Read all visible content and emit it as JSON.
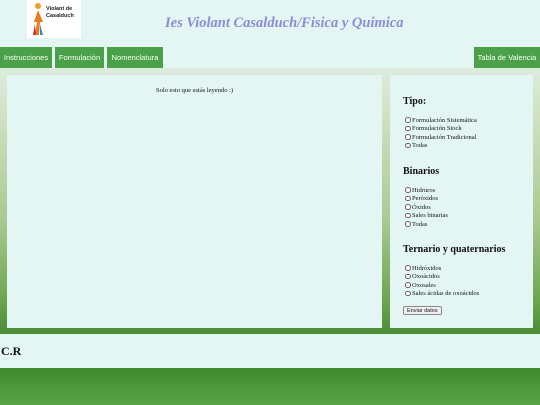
{
  "header": {
    "logo_line1": "Violant de",
    "logo_line2": "Casalduch",
    "title": "Ies Violant Casalduch/Fisica y Quimica"
  },
  "nav": {
    "items": [
      "Instrucciones",
      "Formulación",
      "Nomenclatura"
    ],
    "right_item": "Tabla de Valencia"
  },
  "main": {
    "message": "Solo esto que estás leyendo :)"
  },
  "form": {
    "sections": [
      {
        "title": "Tipo:",
        "options": [
          "Formulación Sistemática",
          "Formulación Stock",
          "Formulación Tradicional",
          "Todas"
        ]
      },
      {
        "title": "Binarios",
        "options": [
          "Hidruros",
          "Peróxidos",
          "Óxidos",
          "Sales binarias",
          "Todas"
        ]
      },
      {
        "title": "Ternario y quaternarios",
        "options": [
          "Hidróxidos",
          "Oxoácidos",
          "Oxosales",
          "Sales ácidas de oxoácidos"
        ]
      }
    ],
    "submit_label": "Enviar datos"
  },
  "footer": {
    "text": "C.R"
  },
  "colors": {
    "nav": "#4aa14a",
    "title": "#8d8bd6",
    "panel": "#e3f6f3"
  }
}
